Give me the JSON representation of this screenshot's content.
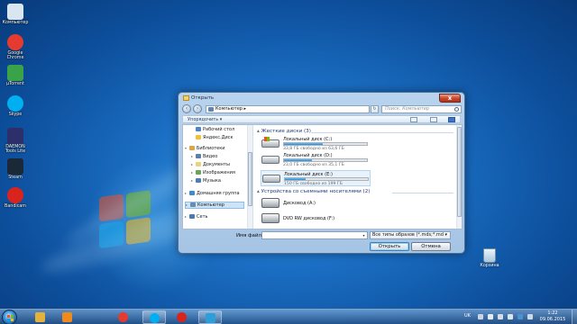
{
  "desktop": {
    "icons": [
      {
        "label": "Компьютер",
        "icon": "computer-icon",
        "color": "#d9e6f2"
      },
      {
        "label": "Google Chrome",
        "icon": "chrome-icon",
        "color": "#e53a2f"
      },
      {
        "label": "µTorrent",
        "icon": "utorrent-icon",
        "color": "#3aa34a"
      },
      {
        "label": "Skype",
        "icon": "skype-icon",
        "color": "#00aff0"
      },
      {
        "label": "DAEMON Tools Lite",
        "icon": "daemon-tools-icon",
        "color": "#2c2f6a"
      },
      {
        "label": "Steam",
        "icon": "steam-icon",
        "color": "#1b2838"
      },
      {
        "label": "Bandicam",
        "icon": "bandicam-icon",
        "color": "#d9231d"
      }
    ],
    "recycle_bin": {
      "label": "Корзина",
      "icon": "recycle-bin-icon"
    }
  },
  "dialog": {
    "title": "Открыть",
    "close_label": "x",
    "address": {
      "path": "Компьютер ▸"
    },
    "search_placeholder": "Поиск: Компьютер",
    "toolbar": {
      "organize_label": "Упорядочить ▾"
    },
    "nav": {
      "items": [
        {
          "label": "Рабочий стол",
          "icon": "desktop-folder-icon",
          "color": "#4d86c6",
          "expand": "",
          "level": 1
        },
        {
          "label": "Яндекс.Диск",
          "icon": "yandex-disk-icon",
          "color": "#f0c130",
          "expand": "",
          "level": 1
        },
        {
          "label": "Библиотеки",
          "icon": "libraries-icon",
          "color": "#d9a64a",
          "expand": "▾",
          "level": 0
        },
        {
          "label": "Видео",
          "icon": "video-icon",
          "color": "#5a7fa8",
          "expand": "▸",
          "level": 1
        },
        {
          "label": "Документы",
          "icon": "documents-icon",
          "color": "#e8d27a",
          "expand": "▸",
          "level": 1
        },
        {
          "label": "Изображения",
          "icon": "images-icon",
          "color": "#6ca35a",
          "expand": "▸",
          "level": 1
        },
        {
          "label": "Музыка",
          "icon": "music-icon",
          "color": "#4c7db8",
          "expand": "▸",
          "level": 1
        },
        {
          "label": "Домашняя группа",
          "icon": "homegroup-icon",
          "color": "#3d8ad0",
          "expand": "▸",
          "level": 0
        },
        {
          "label": "Компьютер",
          "icon": "computer-icon",
          "color": "#6a8cb0",
          "expand": "▸",
          "level": 0,
          "selected": true
        },
        {
          "label": "Сеть",
          "icon": "network-icon",
          "color": "#4a7ab0",
          "expand": "▸",
          "level": 0
        }
      ]
    },
    "groups": {
      "hard_disks": {
        "label": "Жесткие диски (3)"
      },
      "removable": {
        "label": "Устройства со съемными носителями (2)"
      }
    },
    "drives": [
      {
        "name": "Локальный диск (C:)",
        "free_text": "33,8 ГБ свободно из 63,6 ГБ",
        "used_fraction": 0.47,
        "selected": false
      },
      {
        "name": "Локальный диск (D:)",
        "free_text": "23,0 ГБ свободно из 35,1 ГБ",
        "used_fraction": 0.34,
        "selected": false
      },
      {
        "name": "Локальный диск (E:)",
        "free_text": "150 ГБ свободно из 199 ГБ",
        "used_fraction": 0.25,
        "selected": true
      }
    ],
    "removable_devices": [
      {
        "name": "Дисковод (A:)",
        "icon": "floppy-drive-icon"
      },
      {
        "name": "DVD RW дисковод (F:)",
        "icon": "dvd-drive-icon"
      }
    ],
    "filename_label": "Имя файла:",
    "filename_value": "",
    "filetype_value": "Все типы образов (*.mds;*.md ▾",
    "open_label": "Открыть",
    "cancel_label": "Отмена"
  },
  "taskbar": {
    "apps": [
      {
        "icon": "explorer-icon",
        "color": "#e4b23a",
        "active": false
      },
      {
        "icon": "media-player-icon",
        "color": "#f08a1c",
        "active": false
      },
      {
        "icon": "chrome-icon",
        "color": "#e53a2f",
        "active": false
      },
      {
        "icon": "skype-icon",
        "color": "#00aff0",
        "active": true
      },
      {
        "icon": "bandicam-icon",
        "color": "#d9231d",
        "active": false
      },
      {
        "icon": "daemon-tools-icon",
        "color": "#2c9ed8",
        "active": true
      }
    ],
    "language": "UK",
    "time": "1:22",
    "date": "09.06.2015"
  },
  "colors": {
    "accent": "#2a88d4",
    "desktop": "#1b6fc4"
  }
}
